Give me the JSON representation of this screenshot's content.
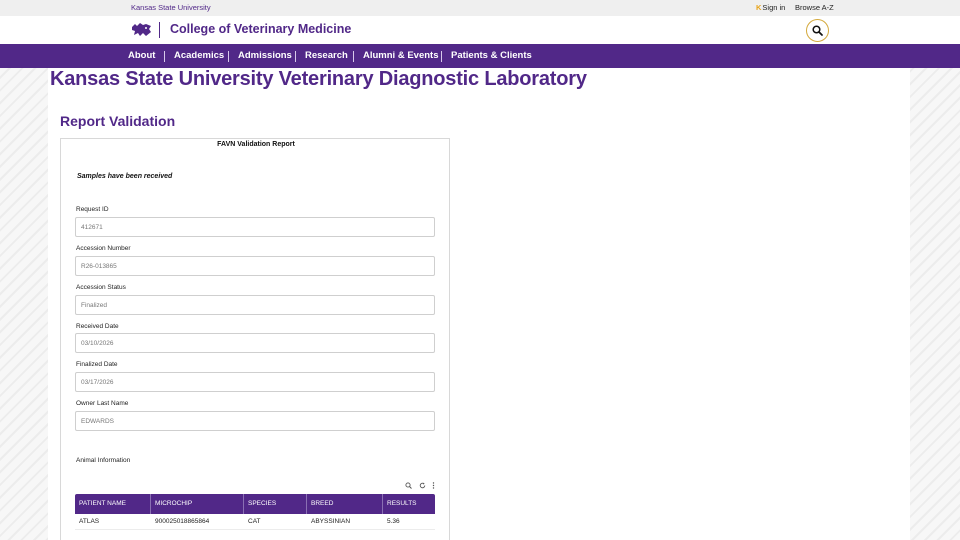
{
  "topbar": {
    "university_link": "Kansas State University",
    "sign_in": "Sign in",
    "browse": "Browse A-Z"
  },
  "header": {
    "college_name": "College of Veterinary Medicine",
    "logo_icon": "powercat-logo-icon",
    "search_icon": "search-icon",
    "accent_gold": "#d4a93c",
    "brand_purple": "#512888"
  },
  "nav": {
    "items": [
      "About",
      "Academics",
      "Admissions",
      "Research",
      "Alumni & Events",
      "Patients & Clients"
    ]
  },
  "page": {
    "lab_title": "Kansas State University Veterinary Diagnostic Laboratory",
    "section_title": "Report Validation"
  },
  "report": {
    "title": "FAVN Validation Report",
    "status_message": "Samples have been received",
    "fields": {
      "request_id": {
        "label": "Request ID",
        "value": "412671"
      },
      "accession_number": {
        "label": "Accession Number",
        "value": "R26-013865"
      },
      "accession_status": {
        "label": "Accession Status",
        "value": "Finalized"
      },
      "received_date": {
        "label": "Received Date",
        "value": "03/10/2026"
      },
      "finalized_date": {
        "label": "Finalized Date",
        "value": "03/17/2026"
      },
      "owner_last_name": {
        "label": "Owner Last Name",
        "value": "EDWARDS"
      }
    },
    "animal_section_label": "Animal Information",
    "table": {
      "tool_icons": [
        "search-icon",
        "refresh-icon",
        "more-vertical-icon"
      ],
      "columns": [
        "PATIENT NAME",
        "MICROCHIP",
        "SPECIES",
        "BREED",
        "RESULTS"
      ],
      "rows": [
        [
          "ATLAS",
          "900025018865864",
          "CAT",
          "ABYSSINIAN",
          "5.36"
        ]
      ]
    }
  }
}
